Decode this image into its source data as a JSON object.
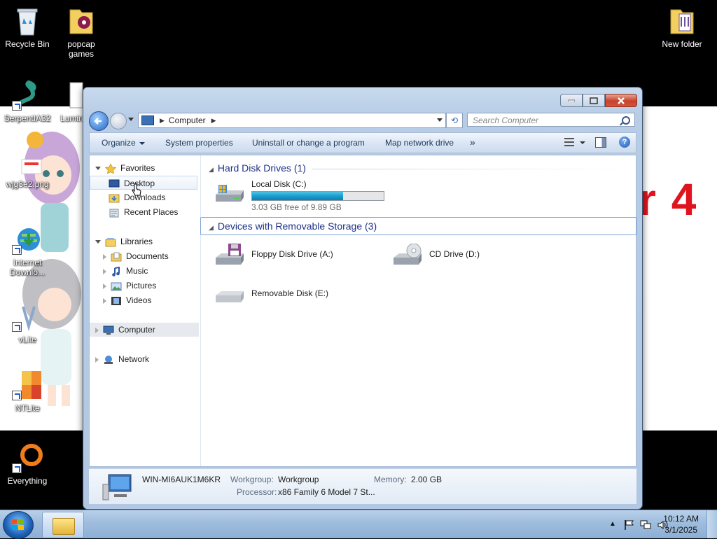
{
  "desktop": {
    "wallpaper_text": "r 4",
    "icons": [
      {
        "label": "Recycle Bin"
      },
      {
        "label": "popcap games"
      },
      {
        "label": "New folder"
      },
      {
        "label": "SerpentIA32"
      },
      {
        "label": "Lumin"
      },
      {
        "label": "wjg3e2.png"
      },
      {
        "label": "Internet Downlo..."
      },
      {
        "label": "vLite"
      },
      {
        "label": "NTLite"
      },
      {
        "label": "Everything"
      }
    ]
  },
  "window": {
    "address": {
      "crumb": "Computer"
    },
    "search": {
      "placeholder": "Search Computer"
    },
    "toolbar": {
      "organize": "Organize",
      "system_properties": "System properties",
      "uninstall": "Uninstall or change a program",
      "map_drive": "Map network drive",
      "more": "»"
    },
    "nav": {
      "favorites": "Favorites",
      "desktop": "Desktop",
      "downloads": "Downloads",
      "recent": "Recent Places",
      "libraries": "Libraries",
      "documents": "Documents",
      "music": "Music",
      "pictures": "Pictures",
      "videos": "Videos",
      "computer": "Computer",
      "network": "Network"
    },
    "groups": {
      "hdd": "Hard Disk Drives (1)",
      "removable": "Devices with Removable Storage (3)"
    },
    "drives": {
      "c": {
        "name": "Local Disk (C:)",
        "free": "3.03 GB free of 9.89 GB",
        "used_fraction": 0.69
      },
      "a": {
        "name": "Floppy Disk Drive (A:)"
      },
      "d": {
        "name": "CD Drive (D:)"
      },
      "e": {
        "name": "Removable Disk (E:)"
      }
    },
    "details": {
      "computer_name": "WIN-MI6AUK1M6KR",
      "workgroup_label": "Workgroup:",
      "workgroup_value": "Workgroup",
      "memory_label": "Memory:",
      "memory_value": "2.00 GB",
      "processor_label": "Processor:",
      "processor_value": "x86 Family 6 Model 7 St..."
    }
  },
  "taskbar": {
    "time": "10:12 AM",
    "date": "3/1/2025"
  },
  "colors": {
    "window_frame": "#b7cce6",
    "progress_fill": "#1696c9",
    "group_header": "#1e3287",
    "wallpaper_accent": "#e0141e"
  }
}
